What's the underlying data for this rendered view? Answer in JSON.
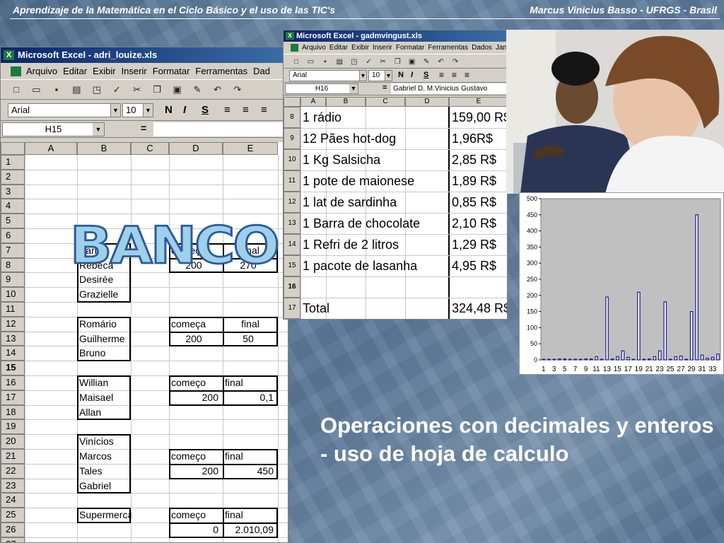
{
  "header": {
    "left": "Aprendizaje de la Matemática en el Ciclo Básico y el uso de las TIC's",
    "right": "Marcus Vinicius Basso - UFRGS - Brasil"
  },
  "excel1": {
    "title": "Microsoft Excel - adri_louize.xls",
    "menu": [
      "Arquivo",
      "Editar",
      "Exibir",
      "Inserir",
      "Formatar",
      "Ferramentas",
      "Dad"
    ],
    "font": "Arial",
    "size": "10",
    "namebox": "H15",
    "formula_eq": "=",
    "columns": [
      "A",
      "B",
      "C",
      "D",
      "E"
    ],
    "rows": [
      "1",
      "2",
      "3",
      "4",
      "5",
      "6",
      "7",
      "8",
      "9",
      "10",
      "11",
      "12",
      "13",
      "14",
      "15",
      "16",
      "17",
      "18",
      "19",
      "20",
      "21",
      "22",
      "23",
      "24",
      "25",
      "26",
      "27"
    ],
    "banco": "BANCO",
    "groups": [
      {
        "names": [
          "Karine",
          "Rebeca",
          "Desirée",
          "Grazielle"
        ],
        "start_label": "começo",
        "end_label": "final",
        "start": "200",
        "end": "270"
      },
      {
        "names": [
          "Romário",
          "Guilherme",
          "Bruno"
        ],
        "start_label": "começa",
        "end_label": "final",
        "start": "200",
        "end": "50"
      },
      {
        "names": [
          "Willian",
          "Maisael",
          "Allan"
        ],
        "start_label": "começo",
        "end_label": "final",
        "start": "200",
        "end": "0,1"
      },
      {
        "names": [
          "Vinícios",
          "Marcos",
          "Tales",
          "Gabriel"
        ],
        "start_label": "começo",
        "end_label": "final",
        "start": "200",
        "end": "450"
      },
      {
        "names": [
          "Supermercado"
        ],
        "start_label": "começo",
        "end_label": "final",
        "start": "0",
        "end": "2.010,09"
      }
    ]
  },
  "excel2": {
    "title": "Microsoft Excel - gadmvingust.xls",
    "menu": [
      "Arquivo",
      "Editar",
      "Exibir",
      "Inserir",
      "Formatar",
      "Ferramentas",
      "Dados",
      "Jane"
    ],
    "font": "Arial",
    "size": "10",
    "namebox": "H16",
    "formula_eq": "=",
    "formula": "Gabriel D.  M.Vinicius  Gustavo",
    "columns": [
      "A",
      "B",
      "C",
      "D",
      "E"
    ],
    "rows": [
      {
        "n": "8",
        "item": "1 rádio",
        "price": "159,00 R$"
      },
      {
        "n": "9",
        "item": "12 Pães hot-dog",
        "price": "1,96R$"
      },
      {
        "n": "10",
        "item": "1 Kg Salsicha",
        "price": "2,85 R$"
      },
      {
        "n": "11",
        "item": "1 pote de maionese",
        "price": "1,89 R$"
      },
      {
        "n": "12",
        "item": "1 lat de sardinha",
        "price": "0,85 R$"
      },
      {
        "n": "13",
        "item": "1 Barra de chocolate",
        "price": "2,10 R$"
      },
      {
        "n": "14",
        "item": "1 Refri de 2 litros",
        "price": "1,29 R$"
      },
      {
        "n": "15",
        "item": "1 pacote de lasanha",
        "price": "4,95 R$"
      },
      {
        "n": "16",
        "item": "",
        "price": ""
      },
      {
        "n": "17",
        "item": "Total",
        "price": "324,48 R$"
      }
    ]
  },
  "chart_data": {
    "type": "bar",
    "x_ticks": [
      "1",
      "3",
      "5",
      "7",
      "9",
      "11",
      "13",
      "15",
      "17",
      "19",
      "21",
      "23",
      "25",
      "27",
      "29",
      "31",
      "33"
    ],
    "values": [
      2,
      2,
      2,
      3,
      3,
      2,
      2,
      2,
      3,
      3,
      10,
      2,
      195,
      3,
      10,
      28,
      8,
      2,
      210,
      2,
      3,
      10,
      28,
      180,
      2,
      10,
      12,
      2,
      150,
      450,
      15,
      5,
      8,
      18
    ],
    "ylim": [
      0,
      500
    ],
    "y_ticks": [
      "0",
      "50",
      "100",
      "150",
      "200",
      "250",
      "300",
      "350",
      "400",
      "450",
      "500"
    ],
    "bar_color": "#1a1a8c"
  },
  "caption": "Operaciones con decimales y enteros - uso de hoja de calculo"
}
